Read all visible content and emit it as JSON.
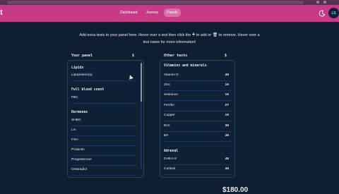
{
  "header": {
    "brand": "t",
    "nav": [
      "Dashboard",
      "Journey",
      "Panels"
    ],
    "active_nav": "Panels",
    "avatar_initials": "LS"
  },
  "intro": {
    "line1_a": "Add extra tests to your panel here. Hover over a test then click the",
    "line1_b": "to add or",
    "line1_c": "to remove. Hover over a",
    "line2": "test name for more information!",
    "plus_glyph": "+",
    "trash_glyph": "🗑"
  },
  "your_panel": {
    "heading": "Your panel",
    "currency": "$",
    "groups": [
      {
        "title": "Lipids",
        "items": [
          "Lipoprotein(a)"
        ]
      },
      {
        "title": "Full blood count",
        "items": [
          "FBC"
        ]
      },
      {
        "title": "Hormones",
        "items": [
          "SHBG",
          "LH",
          "FSH",
          "Prolactin",
          "Progesterone",
          "Oestradiol"
        ]
      }
    ]
  },
  "other_tests": {
    "heading": "Other tests",
    "currency": "$",
    "groups": [
      {
        "title": "Vitamins and minerals",
        "items": [
          {
            "name": "Vitamin D",
            "price": "46"
          },
          {
            "name": "Zinc",
            "price": "15"
          },
          {
            "name": "Selenium",
            "price": "15"
          },
          {
            "name": "Ferritin",
            "price": "27"
          },
          {
            "name": "Copper",
            "price": "15"
          },
          {
            "name": "B12",
            "price": "36"
          },
          {
            "name": "B9",
            "price": "36"
          }
        ]
      },
      {
        "title": "Adrenal",
        "items": [
          {
            "name": "DHEA-S",
            "price": "46"
          },
          {
            "name": "Cortisol",
            "price": "46"
          }
        ]
      }
    ]
  },
  "total": "$180.00"
}
